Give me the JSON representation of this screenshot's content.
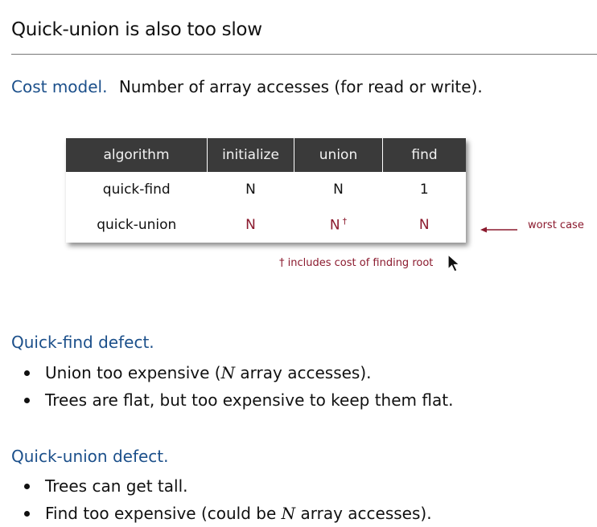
{
  "title": "Quick-union is also too slow",
  "cost_model": {
    "heading": "Cost model.",
    "text": "Number of array accesses (for read or write)."
  },
  "table": {
    "headers": [
      "algorithm",
      "initialize",
      "union",
      "find"
    ],
    "rows": [
      [
        "quick-find",
        "N",
        "N",
        "1"
      ],
      [
        "quick-union",
        "N",
        "N",
        "N"
      ]
    ],
    "dagger": "†"
  },
  "annotation": {
    "worst_case": "worst case",
    "footnote": "† includes cost of finding root"
  },
  "quick_find_defect": {
    "heading": "Quick-find defect.",
    "bullets": [
      {
        "pre": "Union too expensive (",
        "var": "N",
        "post": " array accesses)."
      },
      {
        "pre": "Trees are flat, but too expensive to keep them flat.",
        "var": "",
        "post": ""
      }
    ]
  },
  "quick_union_defect": {
    "heading": "Quick-union defect.",
    "bullets": [
      {
        "pre": "Trees can get tall.",
        "var": "",
        "post": ""
      },
      {
        "pre": "Find too expensive (could be ",
        "var": "N",
        "post": " array accesses)."
      }
    ]
  },
  "colors": {
    "heading_blue": "#1b4f8a",
    "accent_red": "#8b1a2e",
    "table_header_bg": "#3a3a3a"
  }
}
